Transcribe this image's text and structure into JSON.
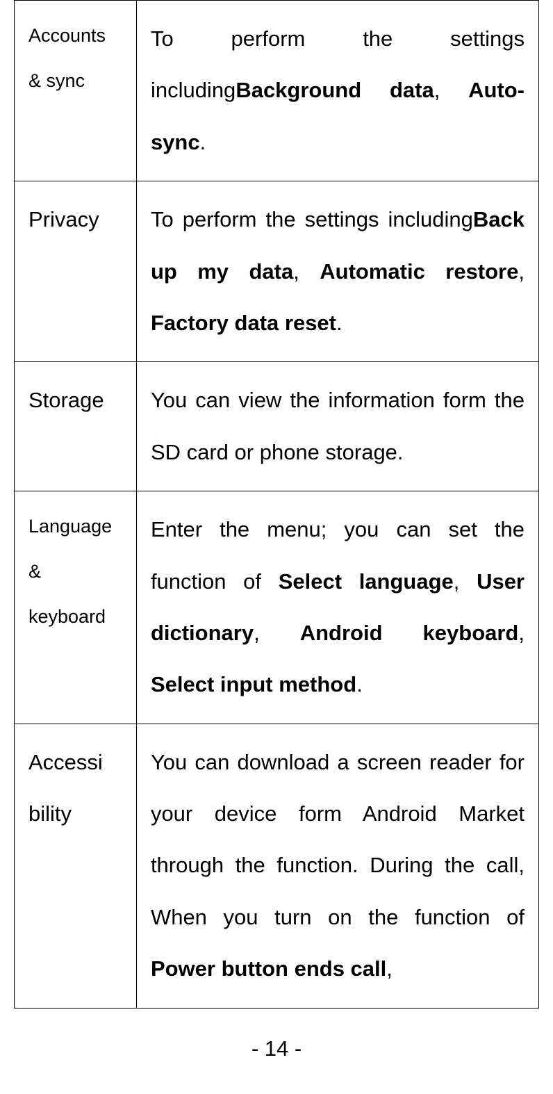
{
  "rows": [
    {
      "label": "Accounts & sync",
      "labelClass": "label",
      "desc_pre": "To perform the settings including",
      "desc_bold1": "Background data",
      "desc_mid1": ", ",
      "desc_bold2": "Auto-sync",
      "desc_post": "."
    },
    {
      "label": "Privacy",
      "labelClass": "label-large",
      "desc_pre": "To perform the settings including",
      "desc_bold1": "Back up my data",
      "desc_mid1": ", ",
      "desc_bold2": "Automatic restore",
      "desc_mid2": ", ",
      "desc_bold3": "Factory data reset",
      "desc_post": "."
    },
    {
      "label": "Storage",
      "labelClass": "label-large",
      "desc_plain": "You can view the information form the SD card or phone storage."
    },
    {
      "label": "Language & keyboard",
      "labelClass": "label",
      "desc_pre": "Enter the menu; you can set the function of ",
      "desc_bold1": "Select language",
      "desc_mid1": ", ",
      "desc_bold2": "User dictionary",
      "desc_mid2": ", ",
      "desc_bold3": "Android keyboard",
      "desc_mid3": ", ",
      "desc_bold4": "Select input method",
      "desc_post": "."
    },
    {
      "label": "Accessi bility",
      "labelClass": "label-large",
      "desc_pre": "You can download a screen reader for your device form Android Market through the function. During the call, When you turn on the function of ",
      "desc_bold1": "Power button ends call",
      "desc_post": ","
    }
  ],
  "page_number": "- 14 -"
}
